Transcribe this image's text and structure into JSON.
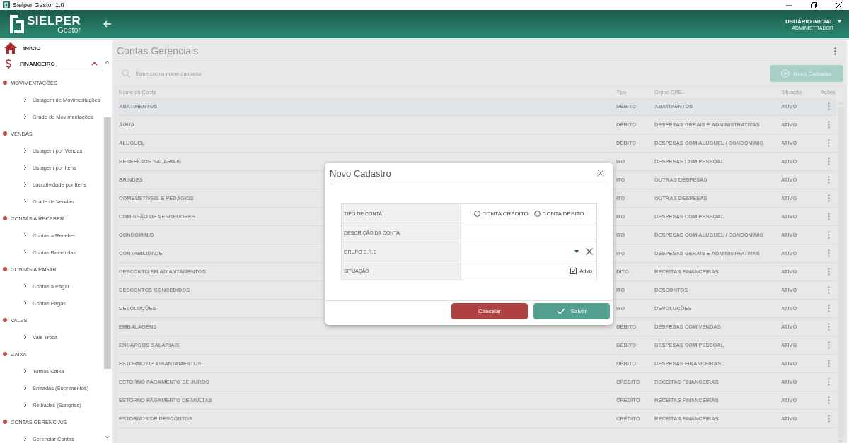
{
  "window": {
    "title": "Sielper Gestor 1.0"
  },
  "header": {
    "brand": "SIELPER",
    "product": "Gestor",
    "user": "USUÁRIO INICIAL",
    "role": "ADMINISTRADOR"
  },
  "sidebar": {
    "items": [
      {
        "label": "INÍCIO",
        "kind": "home"
      },
      {
        "label": "FINANCEIRO",
        "kind": "money",
        "expanded": true,
        "children": [
          {
            "label": "MOVIMENTAÇÕES",
            "children": [
              {
                "label": "Listagem de Movimentações"
              },
              {
                "label": "Grade de Movimentações"
              }
            ]
          },
          {
            "label": "VENDAS",
            "children": [
              {
                "label": "Listagem por Vendas"
              },
              {
                "label": "Listagem por Itens"
              },
              {
                "label": "Lucratividade por Itens"
              },
              {
                "label": "Grade de Vendas"
              }
            ]
          },
          {
            "label": "CONTAS A RECEBER",
            "children": [
              {
                "label": "Contas a Receber"
              },
              {
                "label": "Contas Recebidas"
              }
            ]
          },
          {
            "label": "CONTAS A PAGAR",
            "children": [
              {
                "label": "Contas a Pagar"
              },
              {
                "label": "Contas Pagas"
              }
            ]
          },
          {
            "label": "VALES",
            "children": [
              {
                "label": "Vale Troca"
              }
            ]
          },
          {
            "label": "CAIXA",
            "children": [
              {
                "label": "Turnos Caixa"
              },
              {
                "label": "Entradas (Suprimentos)"
              },
              {
                "label": "Retiradas (Sangrias)"
              }
            ]
          },
          {
            "label": "CONTAS GERENCIAIS",
            "children": [
              {
                "label": "Gerenciar Contas"
              }
            ]
          }
        ]
      }
    ]
  },
  "page": {
    "title": "Contas Gerenciais",
    "search": {
      "placeholder": "Entre com o nome da conta"
    },
    "new_button": "Novo Cadastro"
  },
  "table": {
    "columns": [
      "Nome da Conta",
      "Tipo",
      "Grupo DRE",
      "Situação",
      "Ações"
    ],
    "rows": [
      {
        "name": "ABATIMENTOS",
        "type": "DÉBITO",
        "group": "ABATIMENTOS",
        "status": "ATIVO",
        "selected": true
      },
      {
        "name": "ÁGUA",
        "type": "DÉBITO",
        "group": "DESPESAS GERAIS E ADMINISTRATIVAS",
        "status": "ATIVO",
        "selected": false
      },
      {
        "name": "ALUGUEL",
        "type": "DÉBITO",
        "group": "DESPESAS COM ALUGUEL / CONDOMÍNIO",
        "status": "ATIVO",
        "selected": false
      },
      {
        "name": "BENEFÍCIOS SALARIAIS",
        "type": "ITO",
        "group": "DESPESAS COM PESSOAL",
        "status": "ATIVO",
        "selected": false
      },
      {
        "name": "BRINDES",
        "type": "ITO",
        "group": "OUTRAS DESPESAS",
        "status": "ATIVO",
        "selected": false
      },
      {
        "name": "COMBUSTÍVEIS E PEDÁGIOS",
        "type": "ITO",
        "group": "OUTRAS DESPESAS",
        "status": "ATIVO",
        "selected": false
      },
      {
        "name": "COMISSÃO DE VENDEDORES",
        "type": "ITO",
        "group": "DESPESAS COM PESSOAL",
        "status": "ATIVO",
        "selected": false
      },
      {
        "name": "CONDOMINIO",
        "type": "ITO",
        "group": "DESPESAS COM ALUGUEL / CONDOMÍNIO",
        "status": "ATIVO",
        "selected": false
      },
      {
        "name": "CONTABILIDADE",
        "type": "ITO",
        "group": "DESPESAS GERAIS E ADMINISTRATIVAS",
        "status": "ATIVO",
        "selected": false
      },
      {
        "name": "DESCONTO EM ADIANTAMENTOS",
        "type": "DITO",
        "group": "RECEITAS FINANCEIRAS",
        "status": "ATIVO",
        "selected": false
      },
      {
        "name": "DESCONTOS CONCEDIDOS",
        "type": "ITO",
        "group": "DESCONTOS",
        "status": "ATIVO",
        "selected": false
      },
      {
        "name": "DEVOLUÇÕES",
        "type": "ITO",
        "group": "DEVOLUÇÕES",
        "status": "ATIVO",
        "selected": false
      },
      {
        "name": "EMBALAGENS",
        "type": "DÉBITO",
        "group": "DESPESAS COM VENDAS",
        "status": "ATIVO",
        "selected": false
      },
      {
        "name": "ENCARGOS SALARIAIS",
        "type": "DÉBITO",
        "group": "DESPESAS COM PESSOAL",
        "status": "ATIVO",
        "selected": false
      },
      {
        "name": "ESTORNO DE ADIANTAMENTOS",
        "type": "DÉBITO",
        "group": "DESPESAS FINANCEIRAS",
        "status": "ATIVO",
        "selected": false
      },
      {
        "name": "ESTORNO PAGAMENTO DE JUROS",
        "type": "CRÉDITO",
        "group": "RECEITAS FINANCEIRAS",
        "status": "ATIVO",
        "selected": false
      },
      {
        "name": "ESTORNO PAGAMENTO DE MULTAS",
        "type": "CRÉDITO",
        "group": "RECEITAS FINANCEIRAS",
        "status": "ATIVO",
        "selected": false
      },
      {
        "name": "ESTORNOS DE DESCONTOS",
        "type": "CRÉDITO",
        "group": "RECEITAS FINANCEIRAS",
        "status": "ATIVO",
        "selected": false
      }
    ]
  },
  "dialog": {
    "title": "Novo Cadastro",
    "fields": [
      {
        "label": "TIPO DE CONTA",
        "kind": "radio",
        "options": [
          {
            "label": "CONTA CRÉDITO",
            "selected": false
          },
          {
            "label": "CONTA DÉBITO",
            "selected": false
          }
        ]
      },
      {
        "label": "DESCRIÇÃO DA CONTA",
        "kind": "text"
      },
      {
        "label": "GRUPO D.R.E",
        "kind": "select"
      },
      {
        "label": "SITUAÇÃO",
        "kind": "checkbox",
        "option": "Ativo",
        "checked": true
      }
    ],
    "buttons": [
      {
        "label": "Cancelar",
        "kind": "cancel"
      },
      {
        "label": "Salvar",
        "kind": "save"
      }
    ]
  }
}
